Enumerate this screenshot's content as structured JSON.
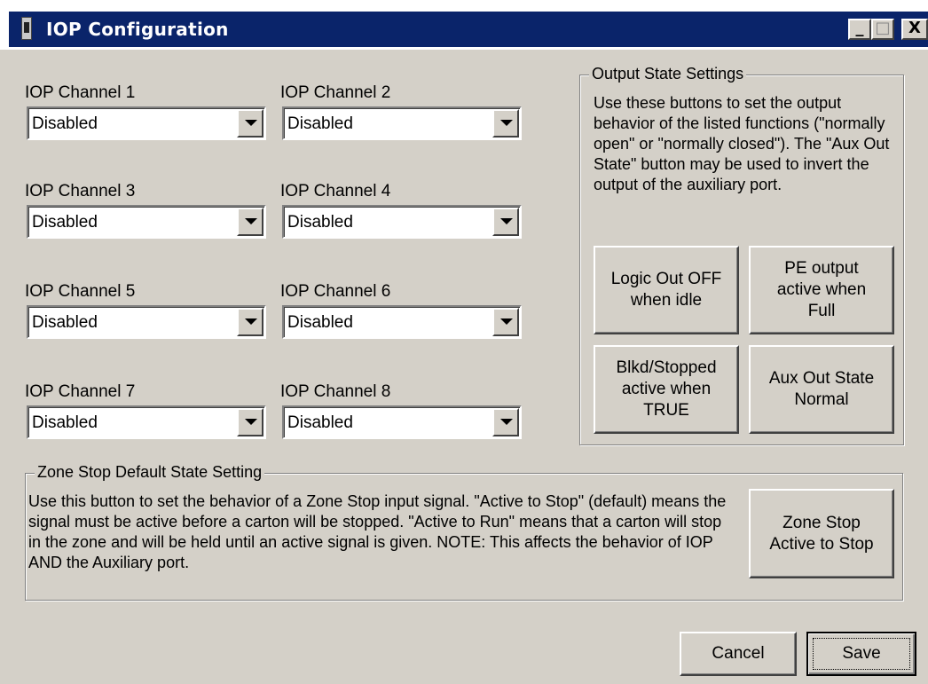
{
  "window": {
    "title": "IOP Configuration",
    "controls": [
      "_",
      "□",
      "X"
    ]
  },
  "channels": [
    {
      "label": "IOP Channel 1",
      "value": "Disabled"
    },
    {
      "label": "IOP Channel 2",
      "value": "Disabled"
    },
    {
      "label": "IOP Channel 3",
      "value": "Disabled"
    },
    {
      "label": "IOP Channel 4",
      "value": "Disabled"
    },
    {
      "label": "IOP Channel 5",
      "value": "Disabled"
    },
    {
      "label": "IOP Channel 6",
      "value": "Disabled"
    },
    {
      "label": "IOP Channel 7",
      "value": "Disabled"
    },
    {
      "label": "IOP Channel 8",
      "value": "Disabled"
    }
  ],
  "output_state": {
    "legend": "Output State Settings",
    "description": "Use these buttons to set the output behavior of the listed functions (\"normally open\" or \"normally closed\"). The \"Aux Out State\" button may be used to invert the output of the auxiliary port.",
    "buttons": {
      "logic_out": "Logic Out OFF\nwhen idle",
      "pe_output": "PE output\nactive when\nFull",
      "blkd_stopped": "Blkd/Stopped\nactive when\nTRUE",
      "aux_out": "Aux Out State\nNormal"
    }
  },
  "zone_stop": {
    "legend": "Zone Stop Default State Setting",
    "description": "Use this button to  set the behavior of a Zone Stop input signal. \"Active to Stop\" (default) means the signal must be active before a carton will be stopped. \"Active to Run\" means that a carton will stop in the zone and will be held until an active signal is given. NOTE: This affects the behavior of IOP AND the Auxiliary port.",
    "button": "Zone Stop\nActive to Stop"
  },
  "footer": {
    "cancel": "Cancel",
    "save": "Save"
  }
}
